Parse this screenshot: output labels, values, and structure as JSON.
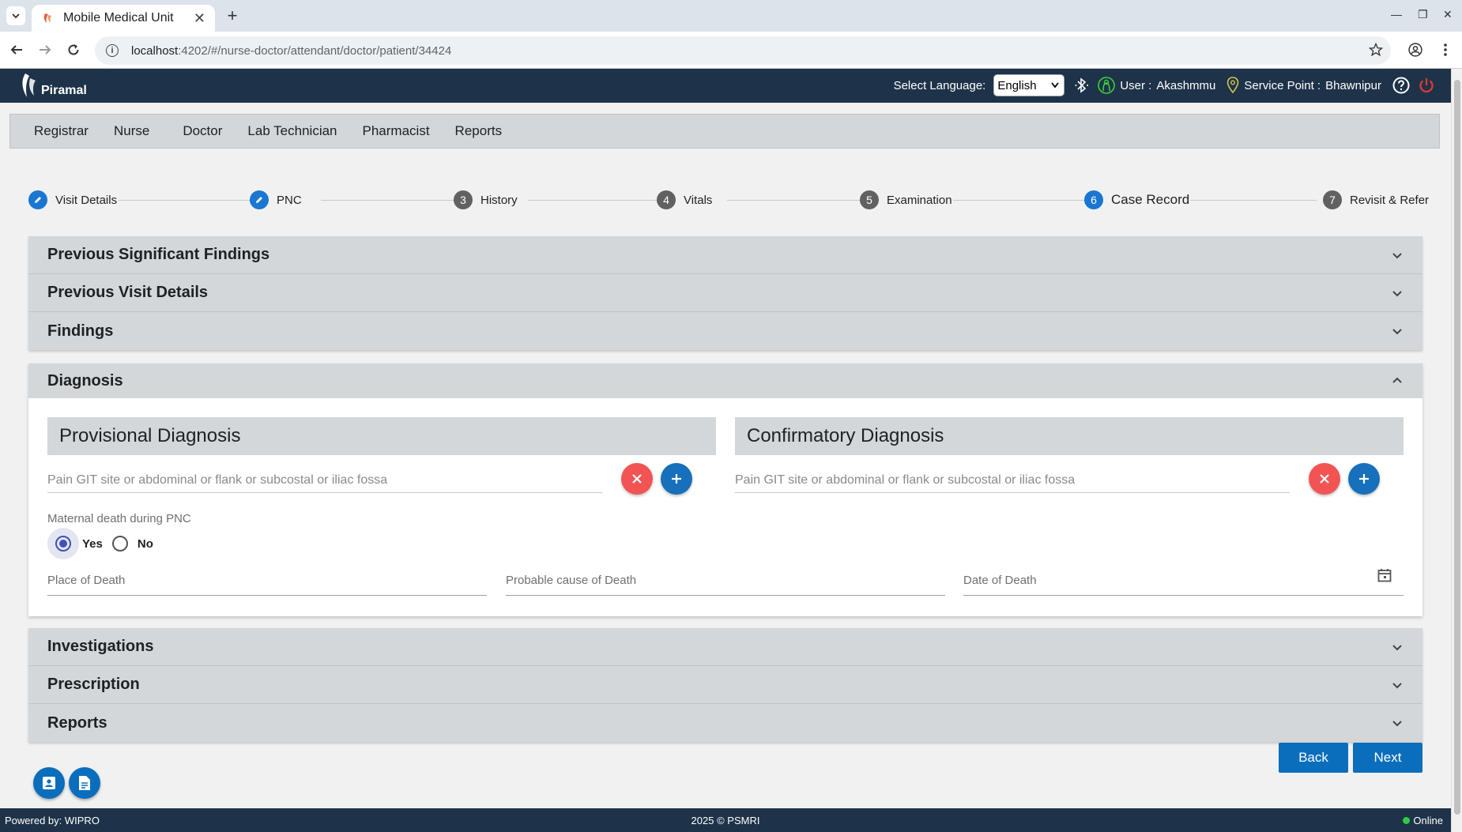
{
  "browser": {
    "tab_title": "Mobile Medical Unit",
    "url_host": "localhost",
    "url_path": ":4202/#/nurse-doctor/attendant/doctor/patient/34424"
  },
  "header": {
    "brand": "Piramal",
    "select_language_label": "Select Language:",
    "language_value": "English",
    "user_label": "User :",
    "user_name": "Akashmmu",
    "service_point_label": "Service Point :",
    "service_point_name": "Bhawnipur"
  },
  "role_nav": [
    "Registrar",
    "Nurse",
    "Doctor",
    "Lab Technician",
    "Pharmacist",
    "Reports"
  ],
  "stepper": [
    {
      "num": "",
      "label": "Visit Details",
      "state": "done"
    },
    {
      "num": "",
      "label": "PNC",
      "state": "done"
    },
    {
      "num": "3",
      "label": "History",
      "state": "todo"
    },
    {
      "num": "4",
      "label": "Vitals",
      "state": "todo"
    },
    {
      "num": "5",
      "label": "Examination",
      "state": "todo"
    },
    {
      "num": "6",
      "label": "Case Record",
      "state": "active"
    },
    {
      "num": "7",
      "label": "Revisit & Refer",
      "state": "todo"
    }
  ],
  "panels_top": [
    "Previous Significant Findings",
    "Previous Visit Details",
    "Findings"
  ],
  "diagnosis": {
    "title": "Diagnosis",
    "provisional_title": "Provisional Diagnosis",
    "provisional_value": "Pain  GIT site  or  abdominal  or  flank  or  subcostal  or  iliac fossa",
    "confirmatory_title": "Confirmatory Diagnosis",
    "confirmatory_value": "Pain  GIT site  or  abdominal  or  flank  or  subcostal  or  iliac fossa",
    "maternal_death_label": "Maternal death during PNC",
    "yes_label": "Yes",
    "no_label": "No",
    "selected": "Yes",
    "place_of_death": "Place of Death",
    "probable_cause": "Probable cause of Death",
    "date_of_death": "Date of Death"
  },
  "panels_bottom": [
    "Investigations",
    "Prescription",
    "Reports"
  ],
  "buttons": {
    "back": "Back",
    "next": "Next"
  },
  "footer": {
    "powered_by": "Powered by: WIPRO",
    "copyright": "2025 © PSMRI",
    "status": "Online"
  },
  "colors": {
    "header_bg": "#1e3349",
    "primary_blue": "#0a6ebd",
    "remove_red": "#f25454",
    "panel_gray": "#d3d7da"
  }
}
